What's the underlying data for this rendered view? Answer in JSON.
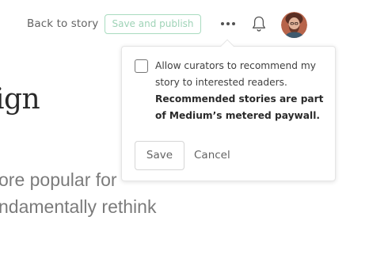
{
  "header": {
    "back_label": "Back to story",
    "publish_label": "Save and publish",
    "more_icon": "more-horizontal-icon",
    "bell_icon": "bell-icon",
    "avatar": "user-avatar"
  },
  "article": {
    "title_fragment": "ign",
    "line1": "ore popular for",
    "line2": "ndamentally rethink"
  },
  "popover": {
    "checkbox_checked": false,
    "text": "Allow curators to recommend my story to interested readers.",
    "bold_text": "Recommended stories are part of Medium’s metered paywall.",
    "save_label": "Save",
    "cancel_label": "Cancel"
  },
  "colors": {
    "accent_green": "#9fd3b7",
    "accent_green_border": "#a9dcc0",
    "text_muted": "#616161"
  }
}
